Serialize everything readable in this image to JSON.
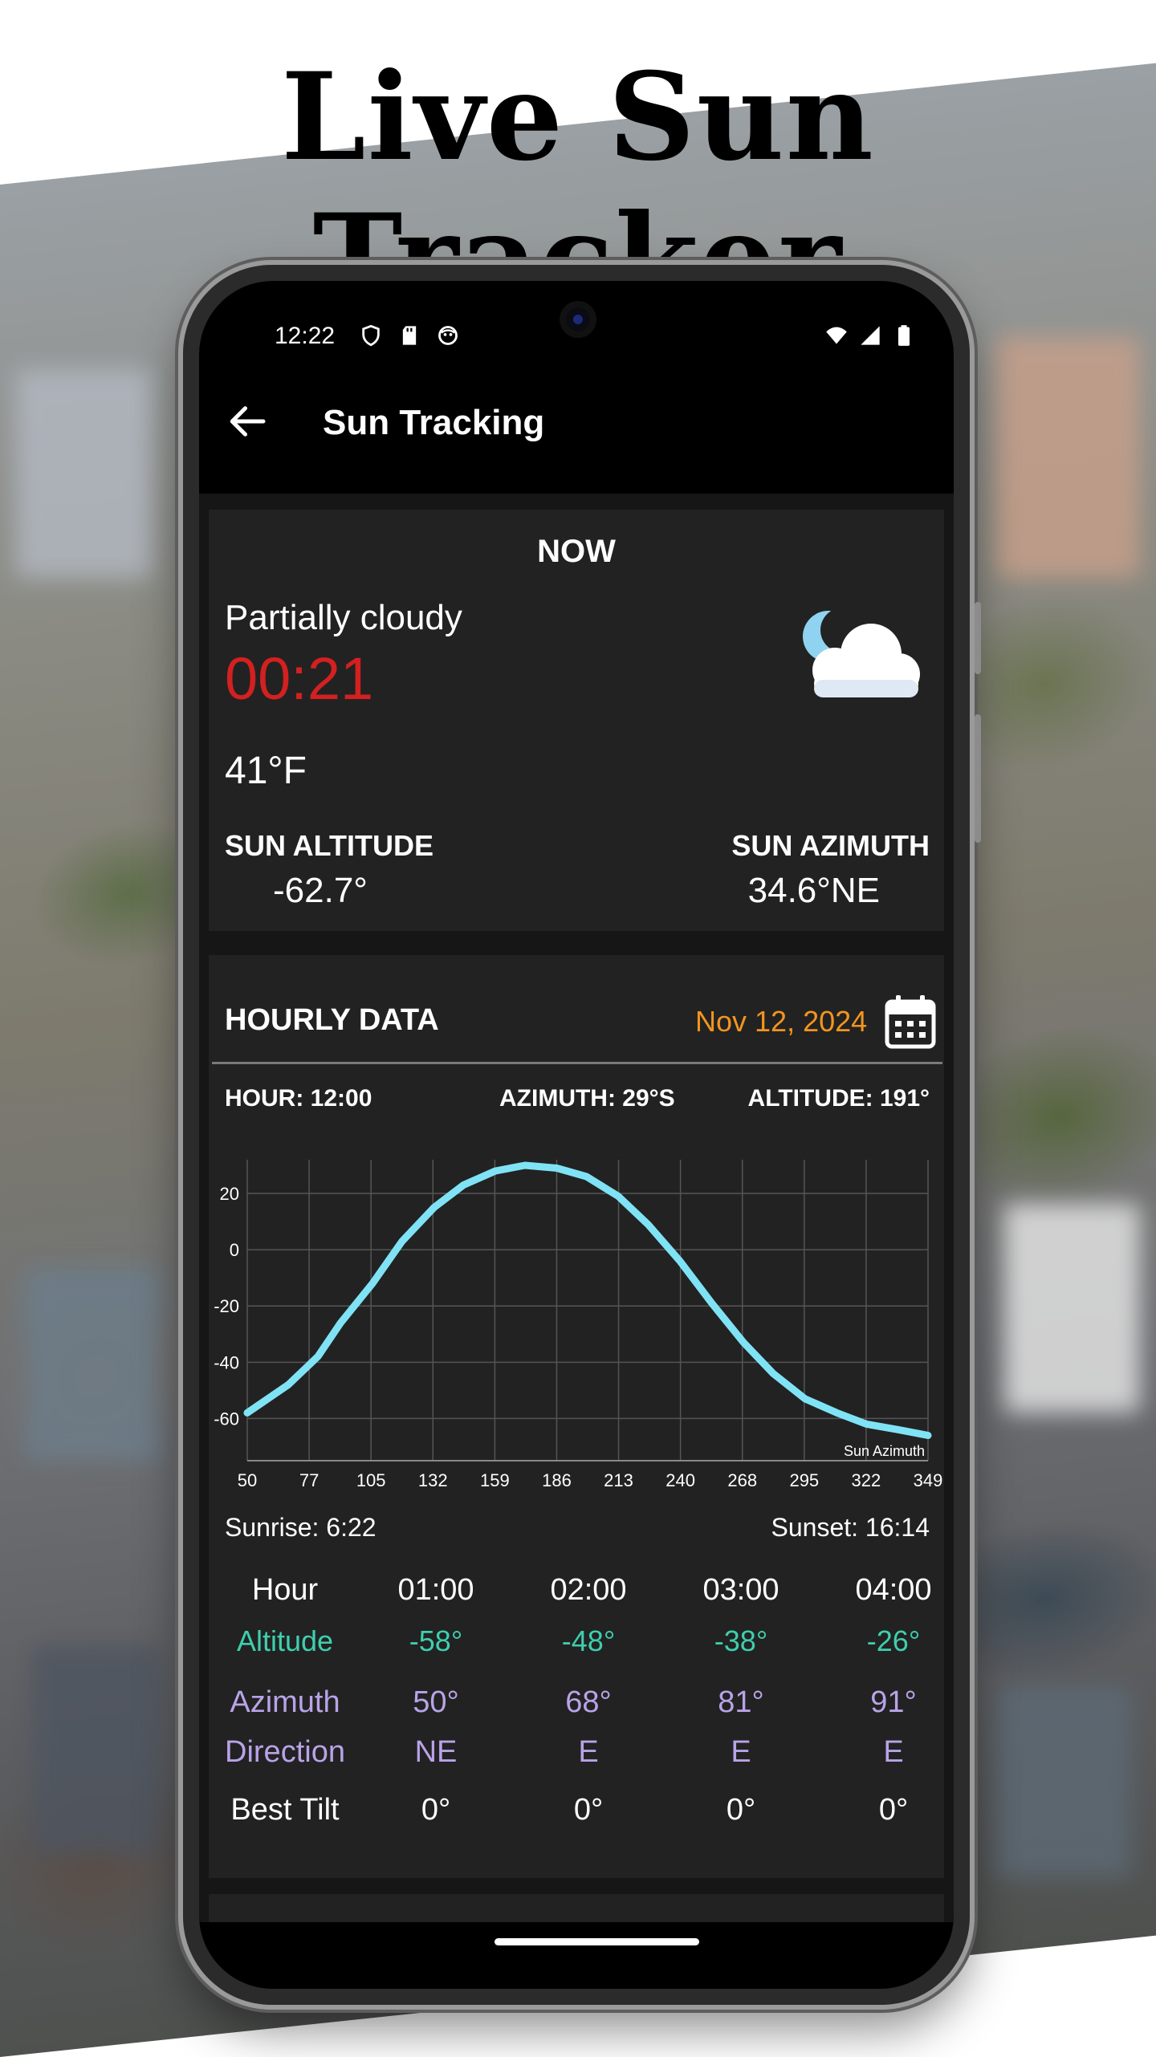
{
  "headline": "Live Sun Tracker",
  "status_bar": {
    "time": "12:22",
    "left_icons": [
      "shield-icon",
      "sd-card-icon",
      "face-icon"
    ],
    "right_icons": [
      "wifi-icon",
      "signal-icon",
      "battery-icon"
    ]
  },
  "app_bar": {
    "title": "Sun Tracking",
    "back_icon": "back-arrow-icon"
  },
  "now": {
    "title": "NOW",
    "condition": "Partially cloudy",
    "time": "00:21",
    "temperature": "41°F",
    "weather_icon": "moon-cloud-icon",
    "sun_altitude_label": "SUN ALTITUDE",
    "sun_altitude_value": "-62.7°",
    "sun_azimuth_label": "SUN AZIMUTH",
    "sun_azimuth_value": "34.6°NE"
  },
  "hourly": {
    "title": "HOURLY DATA",
    "date": "Nov 12, 2024",
    "calendar_icon": "calendar-icon",
    "hour_label": "HOUR: 12:00",
    "azimuth_label": "AZIMUTH: 29°S",
    "altitude_label": "ALTITUDE: 191°",
    "sunrise": "Sunrise: 6:22",
    "sunset": "Sunset: 16:14",
    "table": {
      "headers": [
        "Hour",
        "01:00",
        "02:00",
        "03:00",
        "04:00"
      ],
      "altitude": [
        "Altitude",
        "-58°",
        "-48°",
        "-38°",
        "-26°"
      ],
      "azimuth": [
        "Azimuth",
        "50°",
        "68°",
        "81°",
        "91°"
      ],
      "direction": [
        "Direction",
        "NE",
        "E",
        "E",
        "E"
      ],
      "best_tilt": [
        "Best Tilt",
        "0°",
        "0°",
        "0°",
        "0°"
      ]
    },
    "colors": {
      "date": "#f2951f",
      "altitude_row": "#3ecfae",
      "azimuth_row": "#b9a3e8",
      "curve": "#7fe3f5",
      "time_now": "#d32020"
    }
  },
  "chart_data": {
    "type": "line",
    "legend": "Sun Azimuth",
    "x_ticks": [
      50,
      77,
      105,
      132,
      159,
      186,
      213,
      240,
      268,
      295,
      322,
      349
    ],
    "y_ticks": [
      20,
      0,
      -20,
      -40,
      -60
    ],
    "xlim": [
      50,
      349
    ],
    "ylim": [
      -75,
      32
    ],
    "grid": true,
    "series": [
      {
        "name": "Sun Azimuth",
        "x": [
          50,
          68,
          81,
          91,
          105,
          118,
          132,
          145,
          159,
          172,
          186,
          199,
          213,
          226,
          240,
          254,
          268,
          281,
          295,
          309,
          322,
          336,
          349
        ],
        "y": [
          -58,
          -48,
          -38,
          -26,
          -12,
          3,
          15,
          23,
          28,
          30,
          29,
          26,
          19,
          9,
          -4,
          -19,
          -33,
          -44,
          -53,
          -58,
          -62,
          -64,
          -66
        ]
      }
    ]
  }
}
